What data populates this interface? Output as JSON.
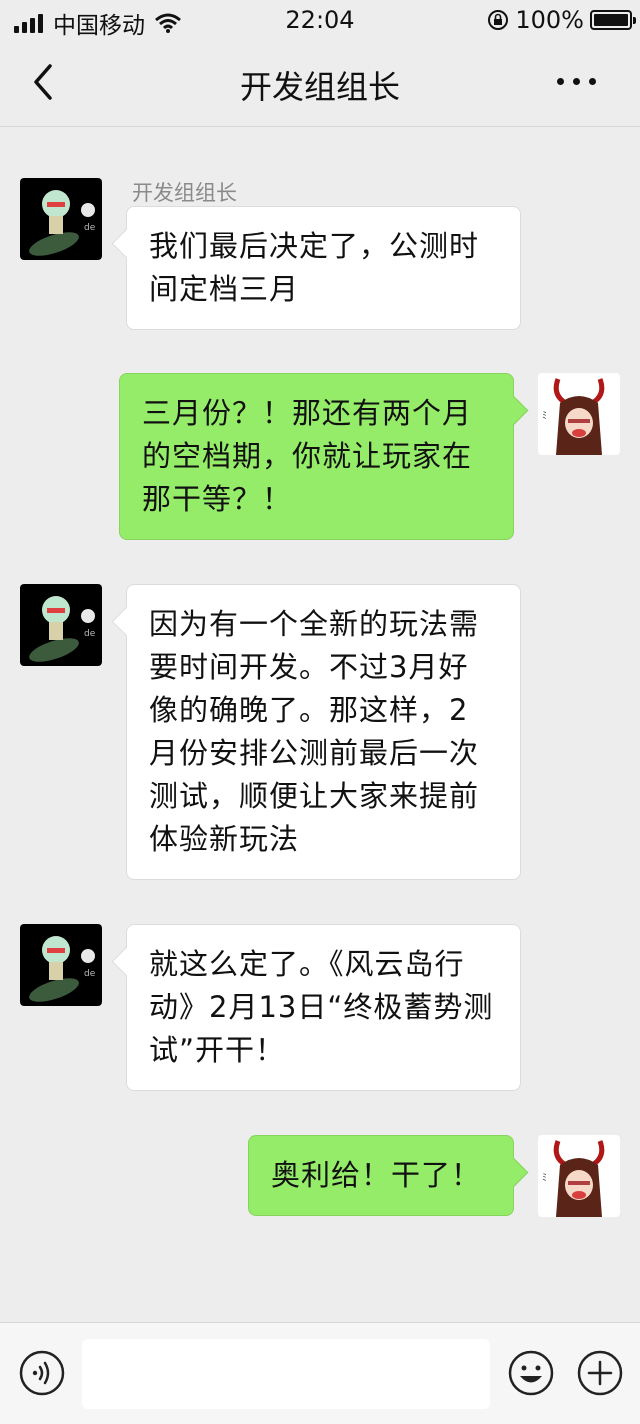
{
  "status_bar": {
    "carrier": "中国移动",
    "time": "22:04",
    "battery": "100%"
  },
  "nav": {
    "title": "开发组组长"
  },
  "messages": [
    {
      "side": "left",
      "sender": "开发组组长",
      "text": "我们最后决定了，公测时间定档三月"
    },
    {
      "side": "right",
      "text": "三月份？！那还有两个月的空档期，你就让玩家在那干等？！"
    },
    {
      "side": "left",
      "text": "因为有一个全新的玩法需要时间开发。不过3月好像的确晚了。那这样，2月份安排公测前最后一次测试，顺便让大家来提前体验新玩法"
    },
    {
      "side": "left",
      "text": "就这么定了。《风云岛行动》2月13日“终极蓄势测试”开干！"
    },
    {
      "side": "right",
      "text": "奥利给！干了！"
    }
  ],
  "icons": {
    "back": "chevron-left-icon",
    "more": "more-icon",
    "voice": "voice-icon",
    "emoji": "emoji-icon",
    "plus": "plus-icon"
  },
  "colors": {
    "bubble_self": "#95ec69",
    "bubble_other": "#ffffff",
    "background": "#ededed"
  }
}
